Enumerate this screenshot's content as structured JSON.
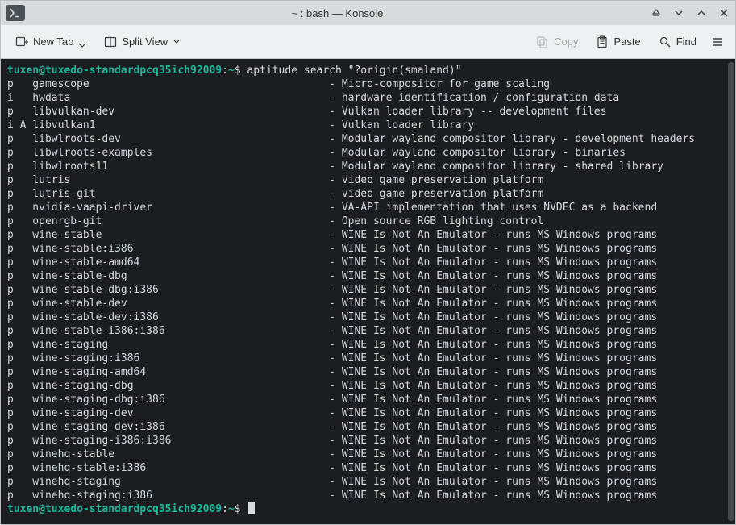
{
  "titlebar": {
    "title": "~ : bash — Konsole"
  },
  "toolbar": {
    "new_tab": "New Tab",
    "split_view": "Split View",
    "copy": "Copy",
    "paste": "Paste",
    "find": "Find"
  },
  "prompt": {
    "user_host": "tuxen@tuxedo-standardpcq35ich92009",
    "colon": ":",
    "path": "~",
    "dollar": "$",
    "command": "aptitude search \"?origin(smaland)\""
  },
  "rows": [
    {
      "flags": "p  ",
      "name": "gamescope",
      "desc": "Micro-compositor for game scaling"
    },
    {
      "flags": "i  ",
      "name": "hwdata",
      "desc": "hardware identification / configuration data"
    },
    {
      "flags": "p  ",
      "name": "libvulkan-dev",
      "desc": "Vulkan loader library -- development files"
    },
    {
      "flags": "i A",
      "name": "libvulkan1",
      "desc": "Vulkan loader library"
    },
    {
      "flags": "p  ",
      "name": "libwlroots-dev",
      "desc": "Modular wayland compositor library - development headers"
    },
    {
      "flags": "p  ",
      "name": "libwlroots-examples",
      "desc": "Modular wayland compositor library - binaries"
    },
    {
      "flags": "p  ",
      "name": "libwlroots11",
      "desc": "Modular wayland compositor library - shared library"
    },
    {
      "flags": "p  ",
      "name": "lutris",
      "desc": "video game preservation platform"
    },
    {
      "flags": "p  ",
      "name": "lutris-git",
      "desc": "video game preservation platform"
    },
    {
      "flags": "p  ",
      "name": "nvidia-vaapi-driver",
      "desc": "VA-API implementation that uses NVDEC as a backend"
    },
    {
      "flags": "p  ",
      "name": "openrgb-git",
      "desc": "Open source RGB lighting control"
    },
    {
      "flags": "p  ",
      "name": "wine-stable",
      "desc": "WINE Is Not An Emulator - runs MS Windows programs"
    },
    {
      "flags": "p  ",
      "name": "wine-stable:i386",
      "desc": "WINE Is Not An Emulator - runs MS Windows programs"
    },
    {
      "flags": "p  ",
      "name": "wine-stable-amd64",
      "desc": "WINE Is Not An Emulator - runs MS Windows programs"
    },
    {
      "flags": "p  ",
      "name": "wine-stable-dbg",
      "desc": "WINE Is Not An Emulator - runs MS Windows programs"
    },
    {
      "flags": "p  ",
      "name": "wine-stable-dbg:i386",
      "desc": "WINE Is Not An Emulator - runs MS Windows programs"
    },
    {
      "flags": "p  ",
      "name": "wine-stable-dev",
      "desc": "WINE Is Not An Emulator - runs MS Windows programs"
    },
    {
      "flags": "p  ",
      "name": "wine-stable-dev:i386",
      "desc": "WINE Is Not An Emulator - runs MS Windows programs"
    },
    {
      "flags": "p  ",
      "name": "wine-stable-i386:i386",
      "desc": "WINE Is Not An Emulator - runs MS Windows programs"
    },
    {
      "flags": "p  ",
      "name": "wine-staging",
      "desc": "WINE Is Not An Emulator - runs MS Windows programs"
    },
    {
      "flags": "p  ",
      "name": "wine-staging:i386",
      "desc": "WINE Is Not An Emulator - runs MS Windows programs"
    },
    {
      "flags": "p  ",
      "name": "wine-staging-amd64",
      "desc": "WINE Is Not An Emulator - runs MS Windows programs"
    },
    {
      "flags": "p  ",
      "name": "wine-staging-dbg",
      "desc": "WINE Is Not An Emulator - runs MS Windows programs"
    },
    {
      "flags": "p  ",
      "name": "wine-staging-dbg:i386",
      "desc": "WINE Is Not An Emulator - runs MS Windows programs"
    },
    {
      "flags": "p  ",
      "name": "wine-staging-dev",
      "desc": "WINE Is Not An Emulator - runs MS Windows programs"
    },
    {
      "flags": "p  ",
      "name": "wine-staging-dev:i386",
      "desc": "WINE Is Not An Emulator - runs MS Windows programs"
    },
    {
      "flags": "p  ",
      "name": "wine-staging-i386:i386",
      "desc": "WINE Is Not An Emulator - runs MS Windows programs"
    },
    {
      "flags": "p  ",
      "name": "winehq-stable",
      "desc": "WINE Is Not An Emulator - runs MS Windows programs"
    },
    {
      "flags": "p  ",
      "name": "winehq-stable:i386",
      "desc": "WINE Is Not An Emulator - runs MS Windows programs"
    },
    {
      "flags": "p  ",
      "name": "winehq-staging",
      "desc": "WINE Is Not An Emulator - runs MS Windows programs"
    },
    {
      "flags": "p  ",
      "name": "winehq-staging:i386",
      "desc": "WINE Is Not An Emulator - runs MS Windows programs"
    }
  ],
  "name_col_width": 47
}
